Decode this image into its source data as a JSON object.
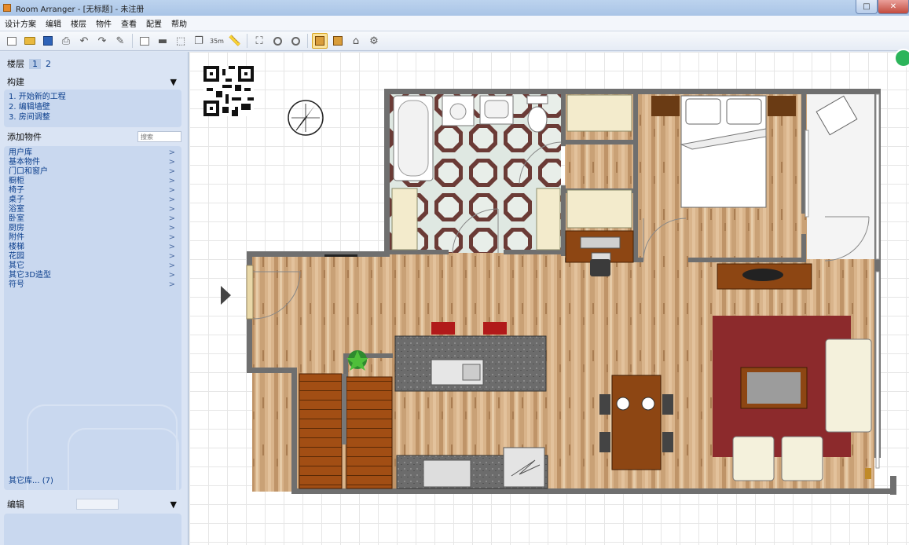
{
  "window": {
    "title": "Room Arranger - [无标题] - 未注册",
    "minimize_label": "–",
    "maximize_label": "□",
    "close_label": "✕"
  },
  "menu": [
    "设计方案",
    "编辑",
    "楼层",
    "物件",
    "查看",
    "配置",
    "帮助"
  ],
  "toolbar": {
    "dimension_label": "35m"
  },
  "left_panel": {
    "floors_label": "楼层",
    "floors": [
      "1",
      "2"
    ],
    "build_header": "构建",
    "build_steps": [
      "1. 开始新的工程",
      "2. 编辑墙壁",
      "3. 房间调整"
    ],
    "add_objects_label": "添加物件",
    "search_placeholder": "搜索",
    "categories": [
      "用户库",
      "基本物件",
      "门口和窗户",
      "橱柜",
      "椅子",
      "桌子",
      "浴室",
      "卧室",
      "厨房",
      "附件",
      "楼梯",
      "花园",
      "其它",
      "其它3D造型",
      "符号"
    ],
    "more_libraries": "其它库... (7)",
    "edit_header": "编辑",
    "collapse_glyph": "▼",
    "chevron_glyph": ">"
  },
  "colors": {
    "titlebar": "#a9c4e6",
    "panel": "#dae4f4",
    "panel_box": "#c9d8ef",
    "link_text": "#0b3e8c",
    "wood_floor": "#d8b48e",
    "wall": "#6f6f6f",
    "rug": "#8c2a2c",
    "counter": "#6f6f6f",
    "stairs": "#9a4a10"
  }
}
